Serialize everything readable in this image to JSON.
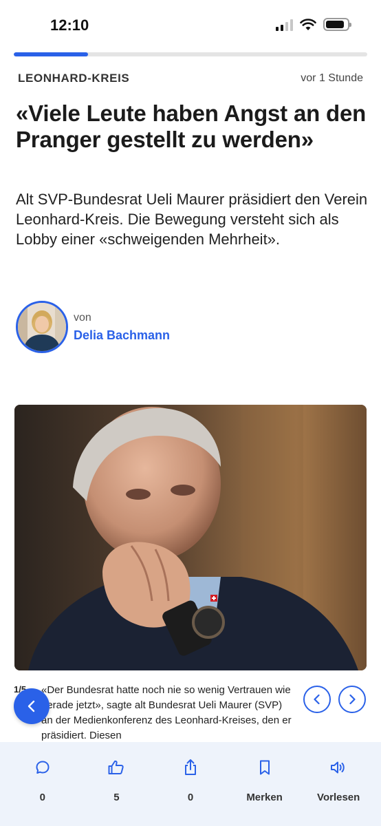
{
  "status_bar": {
    "time": "12:10",
    "battery_level": 0.85
  },
  "reading_progress": 0.21,
  "article": {
    "kicker": "LEONHARD-KREIS",
    "timestamp": "vor 1 Stunde",
    "headline": "«Viele Leute haben Angst an den Pranger gestellt zu werden»",
    "lead": "Alt SVP-Bundesrat Ueli Maurer präsidiert den Verein Leonhard-Kreis. Die Bewegung versteht sich als Lobby einer «schweigenden Mehrheit».",
    "author": {
      "prefix": "von",
      "name": "Delia Bachmann"
    }
  },
  "gallery": {
    "counter": "1/5",
    "caption": "«Der Bundesrat hatte noch nie so wenig Vertrauen wie gerade jetzt», sagte alt Bundesrat Ueli Maurer (SVP) an der Medienkonferenz des Leonhard-Kreises, den er präsidiert. Diesen"
  },
  "bottom_bar": {
    "comments": {
      "icon": "comment-icon",
      "label": "0"
    },
    "likes": {
      "icon": "thumbs-up-icon",
      "label": "5"
    },
    "share": {
      "icon": "share-icon",
      "label": "0"
    },
    "bookmark": {
      "icon": "bookmark-icon",
      "label": "Merken"
    },
    "read_aloud": {
      "icon": "speaker-icon",
      "label": "Vorlesen"
    }
  },
  "colors": {
    "accent": "#2a61e8",
    "bottom_bar_bg": "#eef3fb"
  }
}
